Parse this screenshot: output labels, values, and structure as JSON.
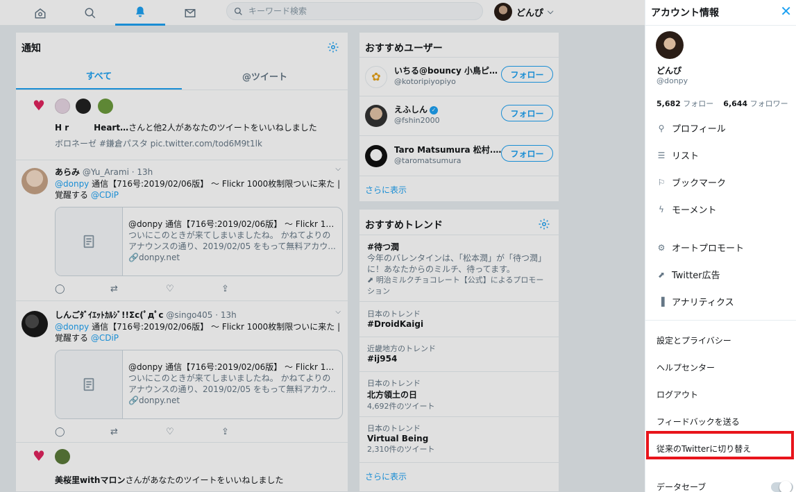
{
  "search": {
    "placeholder": "キーワード検索"
  },
  "account": {
    "name": "どんぴ"
  },
  "notifications": {
    "title": "通知",
    "tabs": [
      "すべて",
      "@ツイート"
    ],
    "like1": {
      "names": "H r　　　Heart…",
      "text": "さんと他2人があなたのツイートをいいねしました",
      "snippet": "ボロネーゼ #鎌倉パスタ pic.twitter.com/tod6M9t1lk"
    },
    "tweets": [
      {
        "name": "あらみ",
        "handle": "@Yu_Arami",
        "time": "· 13h",
        "mention": "@donpy",
        "body": " 通信【716号:2019/02/06版】 ～ Flickr 1000枚制限ついに来た | 覚醒する ",
        "via": "@CDiP",
        "card_title": "@donpy 通信【716号:2019/02/06版】 ～ Flickr 1000...",
        "card_desc": "ついにこのときが来てしまいましたね。 かねてよりのアナウンスの通り、2019/02/05 をもって無料アカウ...",
        "card_domain": "donpy.net"
      },
      {
        "name": "しんごﾀﾞｲｴｯﾄｶﾙｼﾞ!!Σc(ﾟдﾟc",
        "handle": "@singo405",
        "time": "· 13h",
        "mention": "@donpy",
        "body": " 通信【716号:2019/02/06版】 ～ Flickr 1000枚制限ついに来た | 覚醒する ",
        "via": "@CDiP",
        "card_title": "@donpy 通信【716号:2019/02/06版】 ～ Flickr 1000...",
        "card_desc": "ついにこのときが来てしまいましたね。 かねてよりのアナウンスの通り、2019/02/05 をもって無料アカウ...",
        "card_domain": "donpy.net"
      }
    ],
    "like2": {
      "names": "美桜里withマロン",
      "text": "さんがあなたのツイートをいいねしました"
    }
  },
  "who_to_follow": {
    "title": "おすすめユーザー",
    "follow_label": "フォロー",
    "more": "さらに表示",
    "users": [
      {
        "name": "いちる@bouncy 小鳥ピ...",
        "handle": "@kotoripiyopiyo",
        "verified": false
      },
      {
        "name": "えふしん",
        "handle": "@fshin2000",
        "verified": true
      },
      {
        "name": "Taro Matsumura 松村...",
        "handle": "@taromatsumura",
        "verified": true
      }
    ]
  },
  "trends": {
    "title": "おすすめトレンド",
    "more": "さらに表示",
    "promoted": {
      "name": "#待つ潤",
      "desc": "今年のバレンタインは、「松本潤」が「待つ潤」に！あなたからのミルチ、待ってます。",
      "by": "明治ミルクチョコレート【公式】によるプロモーション"
    },
    "items": [
      {
        "ctx": "日本のトレンド",
        "name": "#DroidKaigi",
        "count": ""
      },
      {
        "ctx": "近畿地方のトレンド",
        "name": "#ij954",
        "count": ""
      },
      {
        "ctx": "日本のトレンド",
        "name": "北方領土の日",
        "count": "4,692件のツイート"
      },
      {
        "ctx": "日本のトレンド",
        "name": "Virtual Being",
        "count": "2,310件のツイート"
      }
    ]
  },
  "drawer": {
    "title": "アカウント情報",
    "name": "どんぴ",
    "handle": "@donpy",
    "following_count": "5,682",
    "following_label": "フォロー",
    "followers_count": "6,644",
    "followers_label": "フォロワー",
    "menu": [
      "プロフィール",
      "リスト",
      "ブックマーク",
      "モーメント",
      "オートプロモート",
      "Twitter広告",
      "アナリティクス"
    ],
    "menu2": [
      "設定とプライバシー",
      "ヘルプセンター",
      "ログアウト",
      "フィードバックを送る",
      "従来のTwitterに切り替え",
      "データセーブ"
    ]
  },
  "colors": {
    "accent": "#1da1f2",
    "like": "#e0245e",
    "highlight": "#e8141b"
  }
}
